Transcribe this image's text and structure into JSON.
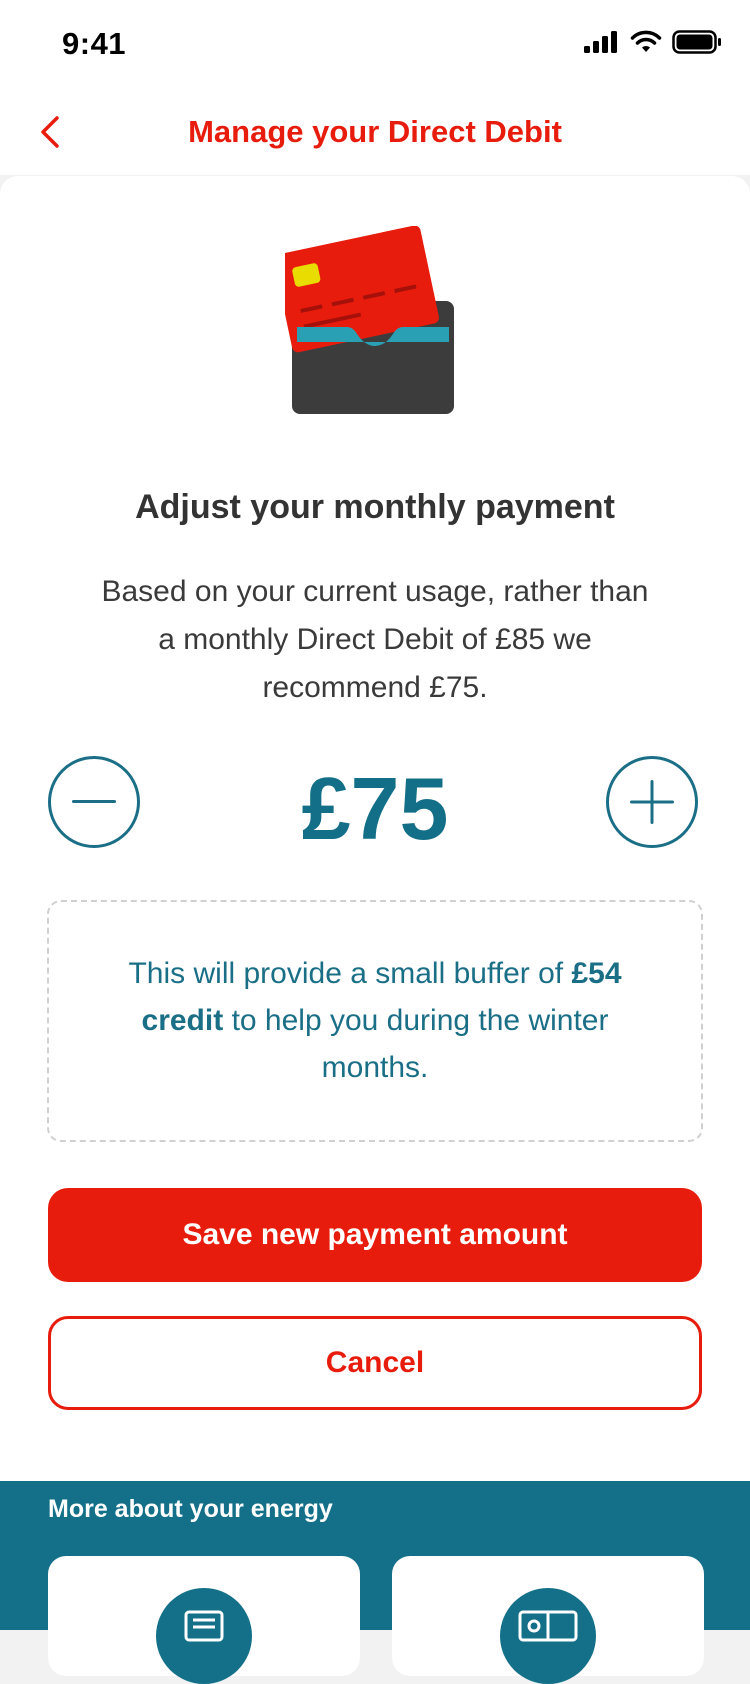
{
  "status_bar": {
    "time": "9:41"
  },
  "nav": {
    "title": "Manage your Direct Debit",
    "back_icon": "chevron-left-icon"
  },
  "main": {
    "heading": "Adjust your monthly payment",
    "description": "Based on your current usage, rather than a monthly Direct Debit of £85 we recommend £75.",
    "amount": "£75",
    "info": {
      "prefix": "This will provide a small buffer of",
      "credit": "£54 credit",
      "suffix": "to help you during the winter months."
    },
    "save_label": "Save new payment amount",
    "cancel_label": "Cancel"
  },
  "more": {
    "title": "More about your energy",
    "tiles": [
      {
        "icon": "document-icon"
      },
      {
        "icon": "meter-icon"
      }
    ]
  },
  "colors": {
    "brand_red": "#e81c0c",
    "teal": "#137088",
    "text": "#3a3a3a"
  }
}
